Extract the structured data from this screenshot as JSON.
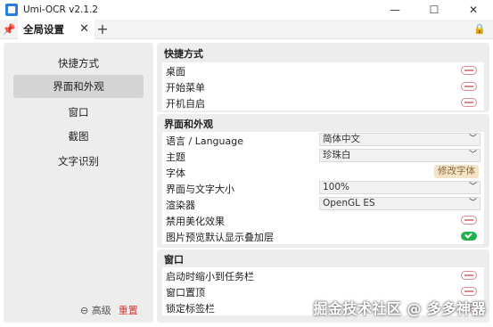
{
  "window": {
    "title": "Umi-OCR v2.1.2",
    "minimize": "—",
    "maximize": "☐",
    "close": "✕"
  },
  "tabbar": {
    "tab_label": "全局设置",
    "tab_close": "✕",
    "add": "+"
  },
  "sidebar": {
    "items": [
      {
        "label": "快捷方式"
      },
      {
        "label": "界面和外观"
      },
      {
        "label": "窗口"
      },
      {
        "label": "截图"
      },
      {
        "label": "文字识别"
      }
    ],
    "advanced": "⊖ 高级",
    "reset": "重置"
  },
  "sections": {
    "shortcuts": {
      "title": "快捷方式",
      "rows": [
        {
          "label": "桌面",
          "toggle": false
        },
        {
          "label": "开始菜单",
          "toggle": false
        },
        {
          "label": "开机自启",
          "toggle": false
        }
      ]
    },
    "ui": {
      "title": "界面和外观",
      "language": {
        "label": "语言 / Language",
        "value": "简体中文"
      },
      "theme": {
        "label": "主题",
        "value": "珍珠白"
      },
      "font": {
        "label": "字体",
        "button": "修改字体"
      },
      "scale": {
        "label": "界面与文字大小",
        "value": "100%"
      },
      "renderer": {
        "label": "渲染器",
        "value": "OpenGL ES"
      },
      "disable_effects": {
        "label": "禁用美化效果",
        "toggle": false
      },
      "preview_overlay": {
        "label": "图片预览默认显示叠加层",
        "toggle": true
      }
    },
    "window": {
      "title": "窗口",
      "rows": [
        {
          "label": "启动时缩小到任务栏",
          "toggle": false
        },
        {
          "label": "窗口置顶",
          "toggle": false
        },
        {
          "label": "锁定标签栏",
          "toggle": false
        }
      ]
    }
  },
  "watermark": "掘金技术社区 @ 多多神器",
  "colors": {
    "toggle_on": "#21b04c",
    "toggle_off_border": "#d98a8a",
    "reset": "#d13a3a",
    "font_button_bg": "#f3e3c8"
  }
}
